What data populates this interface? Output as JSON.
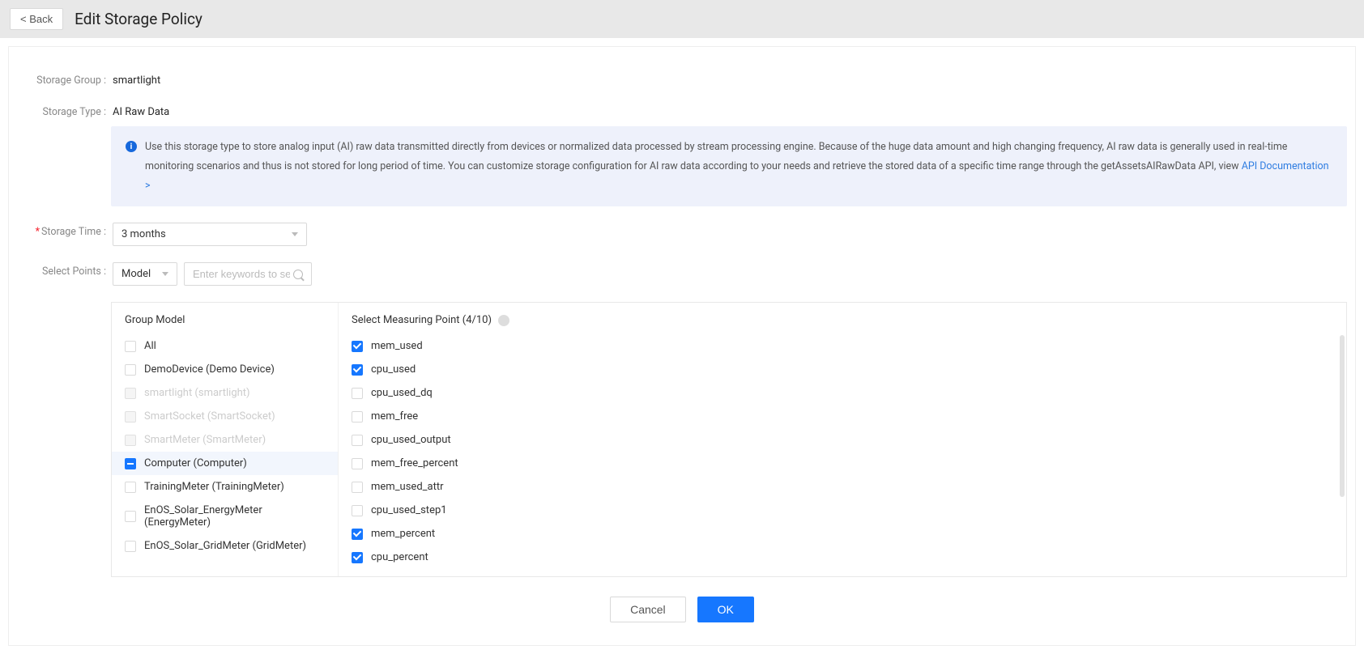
{
  "header": {
    "back_label": "< Back",
    "title": "Edit Storage Policy"
  },
  "form": {
    "storage_group_label": "Storage Group :",
    "storage_group_value": "smartlight",
    "storage_type_label": "Storage Type :",
    "storage_type_value": "AI Raw Data",
    "info_text": "Use this storage type to store analog input (AI) raw data transmitted directly from devices or normalized data processed by stream processing engine. Because of the huge data amount and high changing frequency, AI raw data is generally used in real-time monitoring scenarios and thus is not stored for long period of time. You can customize storage configuration for AI raw data according to your needs and retrieve the stored data of a specific time range through the getAssetsAIRawData API, view ",
    "info_link": "API Documentation >",
    "storage_time_label": "Storage Time :",
    "storage_time_value": "3 months",
    "select_points_label": "Select Points :",
    "scope_select_value": "Model",
    "search_placeholder": "Enter keywords to searc"
  },
  "panel": {
    "group_header": "Group Model",
    "points_header": "Select Measuring Point (4/10)",
    "models": [
      {
        "label": "All",
        "state": "unchecked",
        "disabled": false,
        "selected": false
      },
      {
        "label": "DemoDevice (Demo Device)",
        "state": "unchecked",
        "disabled": false,
        "selected": false
      },
      {
        "label": "smartlight (smartlight)",
        "state": "unchecked",
        "disabled": true,
        "selected": false
      },
      {
        "label": "SmartSocket (SmartSocket)",
        "state": "unchecked",
        "disabled": true,
        "selected": false
      },
      {
        "label": "SmartMeter (SmartMeter)",
        "state": "unchecked",
        "disabled": true,
        "selected": false
      },
      {
        "label": "Computer (Computer)",
        "state": "indeterminate",
        "disabled": false,
        "selected": true
      },
      {
        "label": "TrainingMeter (TrainingMeter)",
        "state": "unchecked",
        "disabled": false,
        "selected": false
      },
      {
        "label": "EnOS_Solar_EnergyMeter (EnergyMeter)",
        "state": "unchecked",
        "disabled": false,
        "selected": false
      },
      {
        "label": "EnOS_Solar_GridMeter (GridMeter)",
        "state": "unchecked",
        "disabled": false,
        "selected": false
      }
    ],
    "points": [
      {
        "label": "mem_used",
        "checked": true
      },
      {
        "label": "cpu_used",
        "checked": true
      },
      {
        "label": "cpu_used_dq",
        "checked": false
      },
      {
        "label": "mem_free",
        "checked": false
      },
      {
        "label": "cpu_used_output",
        "checked": false
      },
      {
        "label": "mem_free_percent",
        "checked": false
      },
      {
        "label": "mem_used_attr",
        "checked": false
      },
      {
        "label": "cpu_used_step1",
        "checked": false
      },
      {
        "label": "mem_percent",
        "checked": true
      },
      {
        "label": "cpu_percent",
        "checked": true
      }
    ]
  },
  "footer": {
    "cancel_label": "Cancel",
    "ok_label": "OK"
  }
}
